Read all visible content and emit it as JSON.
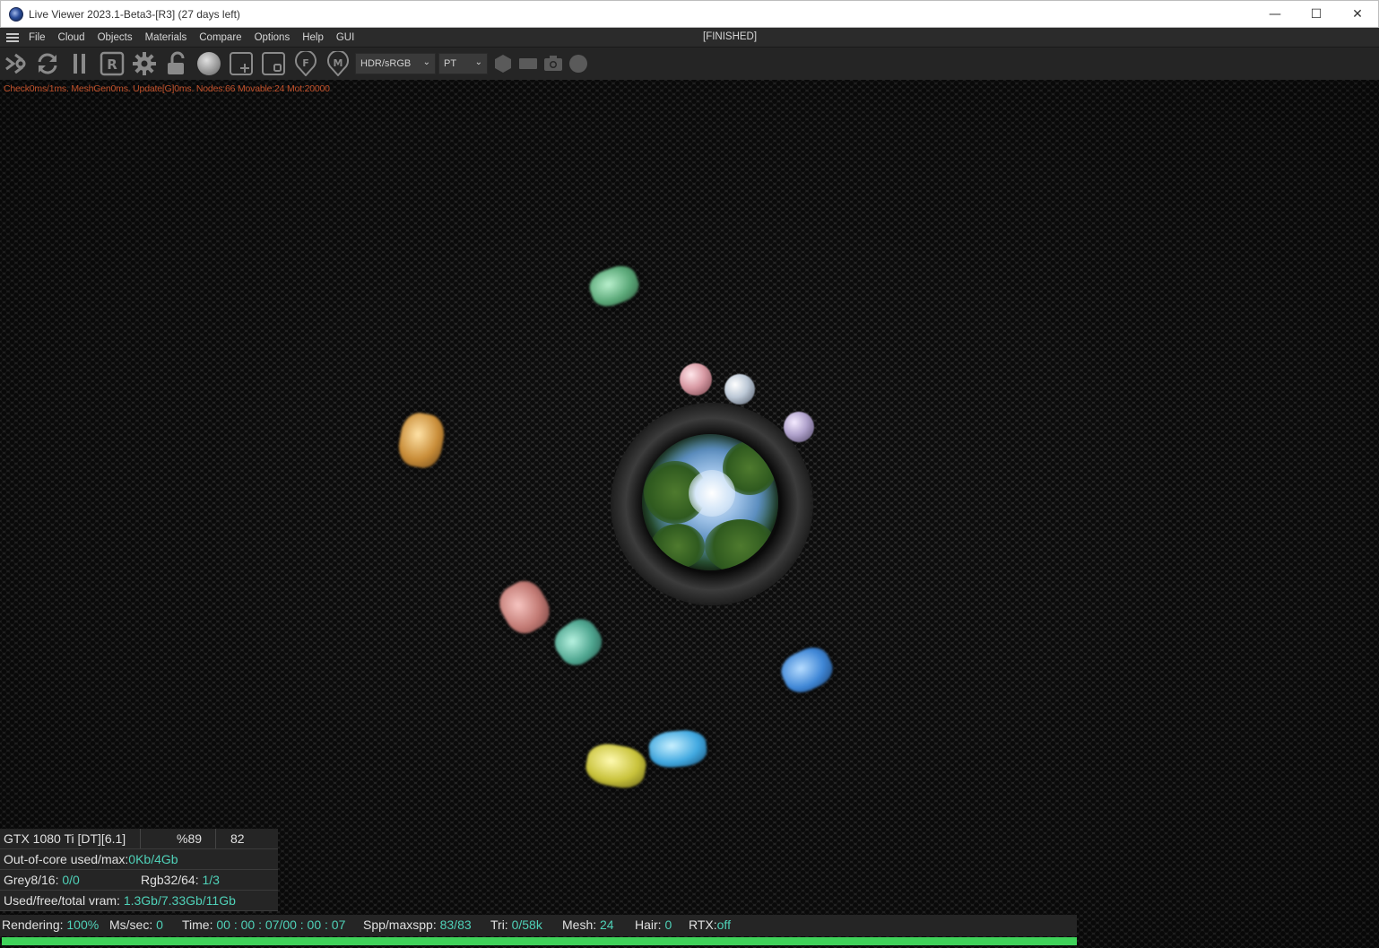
{
  "window": {
    "title": "Live Viewer 2023.1-Beta3-[R3] (27 days left)",
    "controls": {
      "minimize": "—",
      "maximize": "☐",
      "close": "✕"
    }
  },
  "menubar": {
    "items": [
      "File",
      "Cloud",
      "Objects",
      "Materials",
      "Compare",
      "Options",
      "Help",
      "GUI"
    ],
    "status": "[FINISHED]"
  },
  "toolbar": {
    "icons": [
      "send-scene-icon",
      "restart-icon",
      "pause-icon",
      "region-render-icon",
      "settings-gear-icon",
      "lock-icon",
      "material-ball-icon",
      "add-region-icon",
      "region-icon",
      "focus-picker-icon",
      "material-picker-icon"
    ],
    "colorspace": {
      "selected": "HDR/sRGB"
    },
    "kernel": {
      "selected": "PT"
    },
    "extra_icons": [
      "hexagon-icon",
      "film-icon",
      "camera-icon",
      "circle-icon"
    ]
  },
  "viewport": {
    "debug_text": "Check0ms/1ms. MeshGen0ms. Update[G]0ms. Nodes:66 Movable:24 Mot:20000"
  },
  "stats": {
    "gpu_name": "GTX 1080 Ti [DT][6.1]",
    "gpu_load": "%89",
    "gpu_temp": "82",
    "out_of_core_label": "Out-of-core used/max:",
    "out_of_core_value": "0Kb/4Gb",
    "grey_label": "Grey8/16:",
    "grey_value": "0/0",
    "rgb_label": "Rgb32/64:",
    "rgb_value": "1/3",
    "vram_label": "Used/free/total vram:",
    "vram_value": "1.3Gb/7.33Gb/11Gb"
  },
  "statusbar": {
    "rendering_label": "Rendering:",
    "rendering_value": "100%",
    "mssec_label": "Ms/sec:",
    "mssec_value": "0",
    "time_label": "Time:",
    "time_value": "00 : 00 : 07/00 : 00 : 07",
    "spp_label": "Spp/maxspp:",
    "spp_value": "83/83",
    "tri_label": "Tri:",
    "tri_value": "0/58k",
    "mesh_label": "Mesh:",
    "mesh_value": "24",
    "hair_label": "Hair:",
    "hair_value": "0",
    "rtx_label": "RTX:",
    "rtx_value": "off"
  },
  "progress": {
    "percent": 100,
    "color": "#3fd35a"
  },
  "colors": {
    "accent_value": "#4fd1b8",
    "debug_text": "#c0502a"
  }
}
